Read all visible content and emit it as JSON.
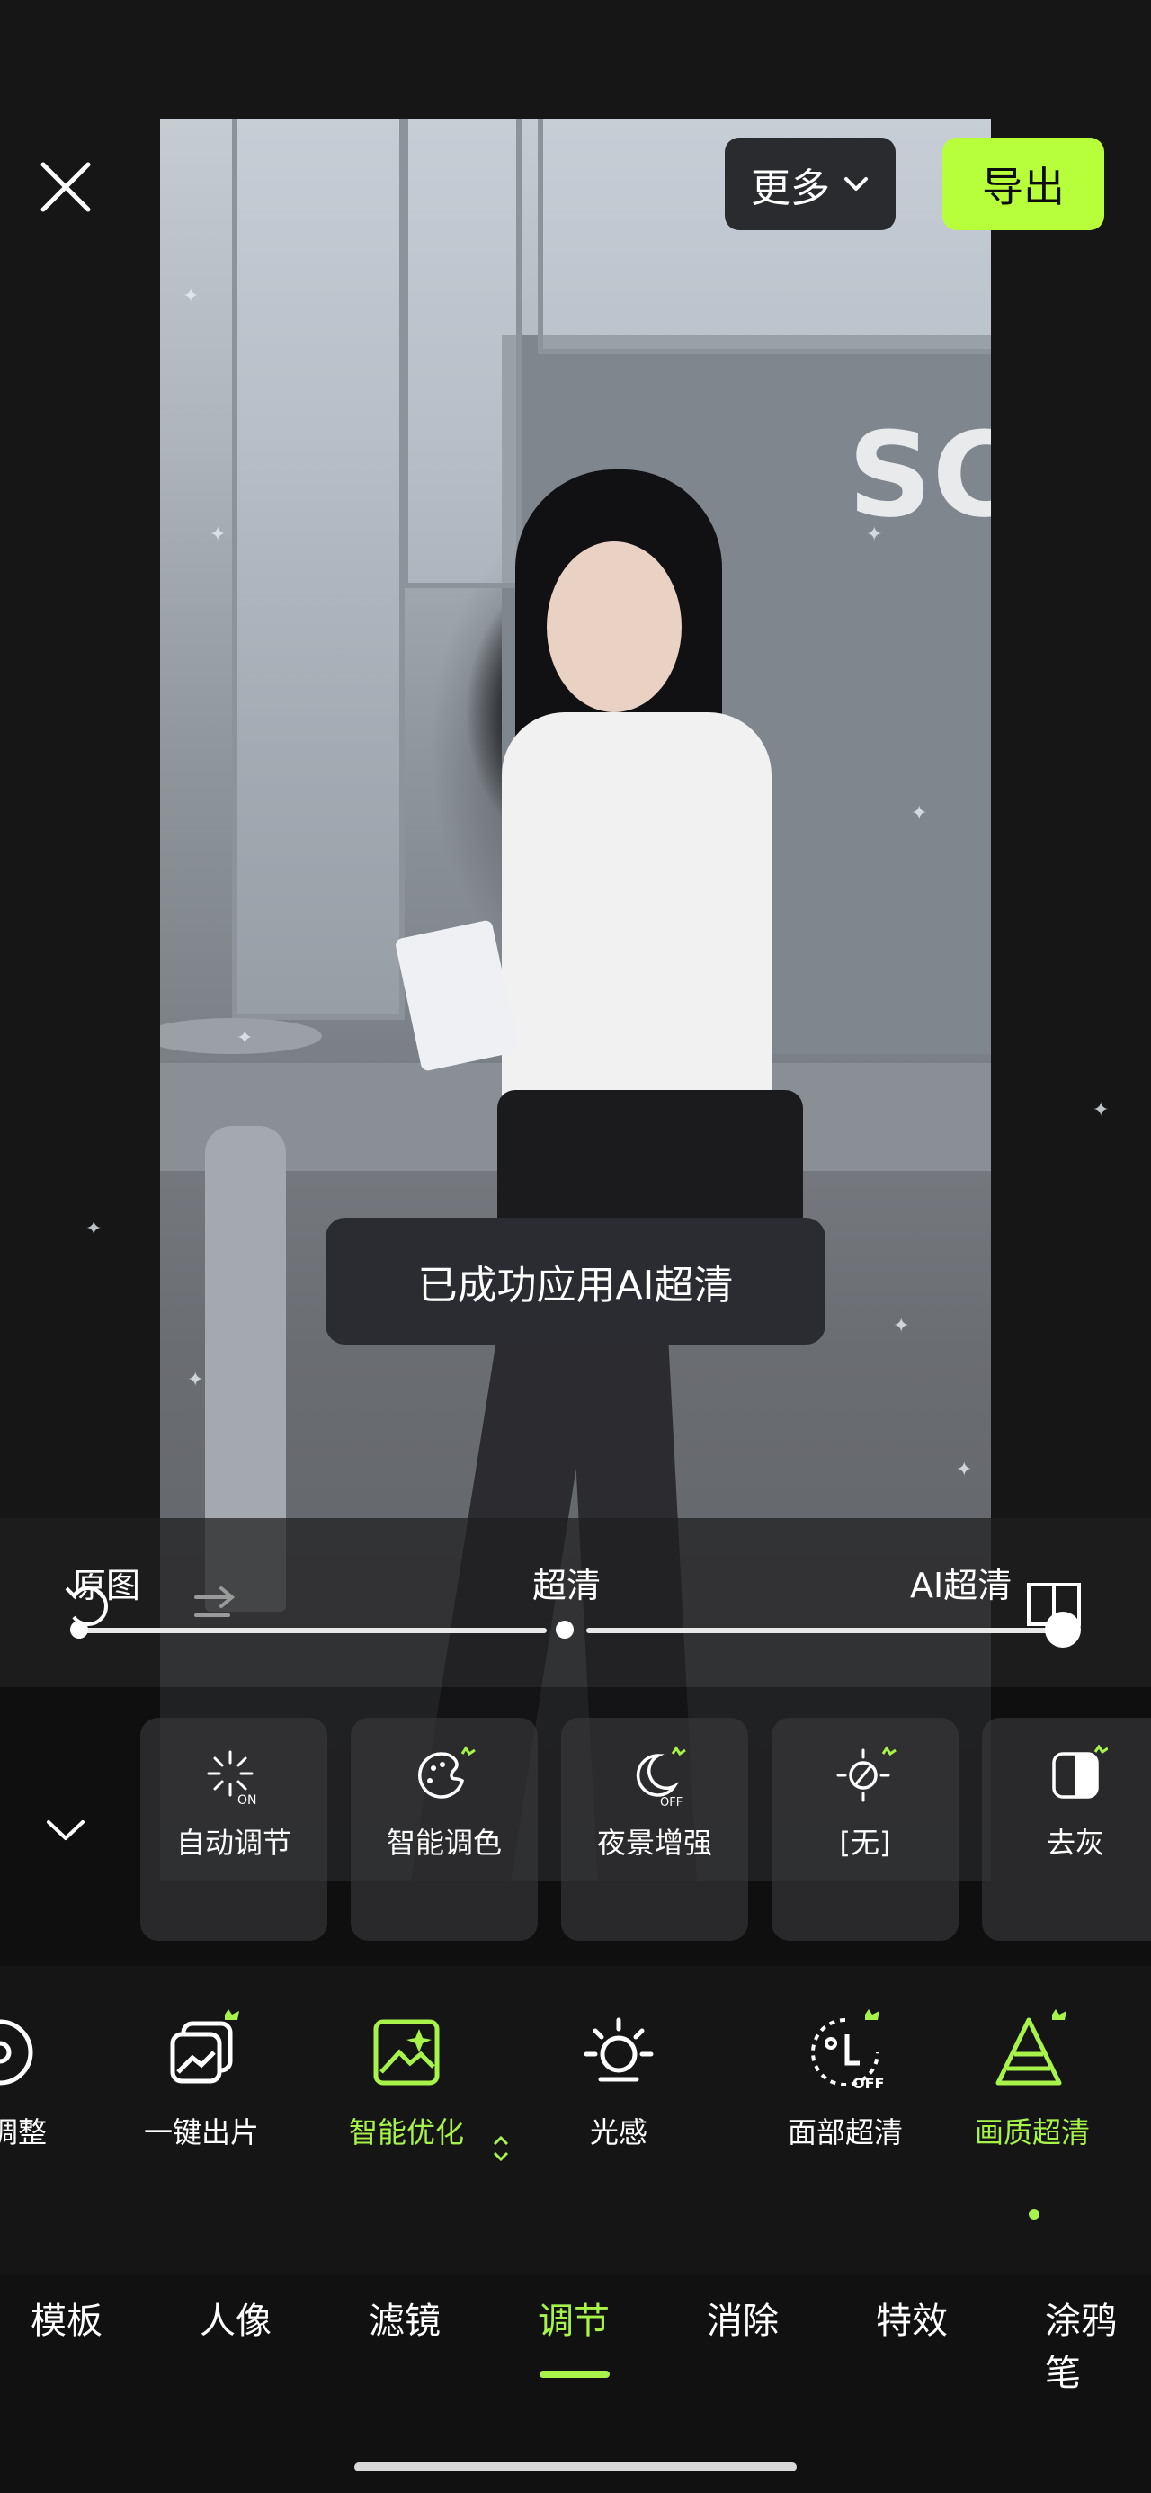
{
  "top_bar": {
    "more_label": "更多",
    "export_label": "导出"
  },
  "photo": {
    "wall_sign_text": "SC"
  },
  "toast": {
    "message": "已成功应用AI超清"
  },
  "slider": {
    "left_label": "原图",
    "middle_label": "超清",
    "right_label": "AI超清",
    "selected_level": "AI超清"
  },
  "feature_cards": [
    {
      "label": "自动调节",
      "icon": "auto-adjust-on-icon"
    },
    {
      "label": "智能调色",
      "icon": "smart-color-icon"
    },
    {
      "label": "夜景增强",
      "icon": "night-enhance-off-icon"
    },
    {
      "label": "[无]",
      "icon": "no-effect-icon"
    },
    {
      "label": "去灰",
      "icon": "dehaze-icon"
    }
  ],
  "tools": [
    {
      "label": "调整",
      "icon": "adjust-icon"
    },
    {
      "label": "一键出片",
      "icon": "one-click-photo-icon"
    },
    {
      "label": "智能优化",
      "icon": "smart-optimize-icon"
    },
    {
      "label": "光感",
      "icon": "light-sense-icon"
    },
    {
      "label": "面部超清",
      "icon": "face-hd-icon"
    },
    {
      "label": "画质超清",
      "icon": "quality-hd-icon"
    }
  ],
  "tabs": [
    {
      "label": "模板"
    },
    {
      "label": "人像"
    },
    {
      "label": "滤镜"
    },
    {
      "label": "调节"
    },
    {
      "label": "消除"
    },
    {
      "label": "特效"
    },
    {
      "label": "涂鸦笔"
    }
  ],
  "colors": {
    "accent": "#A7F34A",
    "export_bg": "#B7FF3B",
    "background": "#161616"
  }
}
